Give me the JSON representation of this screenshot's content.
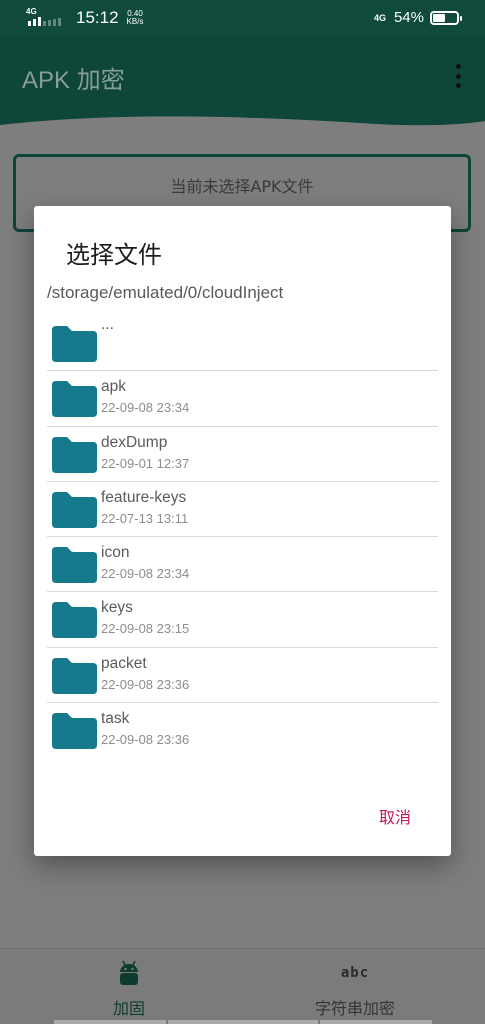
{
  "status_bar": {
    "network_tag": "4G",
    "time": "15:12",
    "speed_value": "0.40",
    "speed_unit": "KB/s",
    "lte_tag": "4G",
    "battery": "54%",
    "battery_level": 0.54
  },
  "app": {
    "title": "APK 加密",
    "menu_icon": "more-vert-icon",
    "file_box_text": "当前未选择APK文件"
  },
  "dialog": {
    "title": "选择文件",
    "path": "/storage/emulated/0/cloudInject",
    "entries": [
      {
        "name": "...",
        "date": ""
      },
      {
        "name": "apk",
        "date": "22-09-08 23:34"
      },
      {
        "name": "dexDump",
        "date": "22-09-01 12:37"
      },
      {
        "name": "feature-keys",
        "date": "22-07-13 13:11"
      },
      {
        "name": "icon",
        "date": "22-09-08 23:34"
      },
      {
        "name": "keys",
        "date": "22-09-08 23:15"
      },
      {
        "name": "packet",
        "date": "22-09-08 23:36"
      },
      {
        "name": "task",
        "date": "22-09-08 23:36"
      }
    ],
    "cancel_label": "取消"
  },
  "bottom_nav": {
    "tabs": [
      {
        "label": "加固",
        "icon": "android-icon",
        "active": true
      },
      {
        "label": "字符串加密",
        "icon": "abc",
        "active": false
      }
    ]
  },
  "colors": {
    "primary": "#0e463a",
    "folder": "#157b8c",
    "accent": "#c2185b"
  }
}
